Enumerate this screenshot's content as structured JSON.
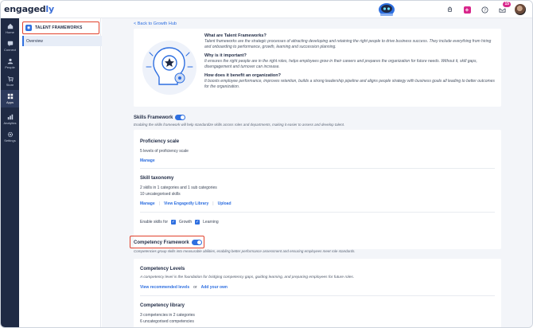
{
  "app": {
    "logo_main": "engaged",
    "logo_accent": "ly",
    "notifications_count": "15"
  },
  "rail": {
    "items": [
      {
        "label": "Home",
        "icon": "home-icon"
      },
      {
        "label": "Connect",
        "icon": "chat-icon"
      },
      {
        "label": "People",
        "icon": "people-icon"
      },
      {
        "label": "Store",
        "icon": "cart-icon"
      },
      {
        "label": "Apps",
        "icon": "apps-icon"
      },
      {
        "label": "Analytics",
        "icon": "analytics-icon"
      },
      {
        "label": "Settings",
        "icon": "gear-icon"
      }
    ]
  },
  "subside": {
    "header": "TALENT FRAMEWORKS",
    "items": [
      {
        "label": "Overview"
      }
    ]
  },
  "main": {
    "back_link": "< Back to Growth Hub",
    "about": {
      "q1": "What are Talent Frameworks?",
      "a1": "Talent frameworks are the strategic processes of attracting developing and retaining the right people to drive business success. They include everything from hiring and onboarding to performance, growth, learning and succession planning.",
      "q2": "Why is it important?",
      "a2": "It ensures the right people are in the right roles, helps employees grow in their careers and prepares the organization for future needs. Without it, skill gaps, disengagement and turnover can increase.",
      "q3": "How does it benefit an organization?",
      "a3": "It boosts employee performance, improves retention, builds a strong leadership pipeline and aligns people strategy with business goals all leading to better outcomes for the organization."
    },
    "skills": {
      "title": "Skills Framework",
      "desc": "Enabling the skills framework will help standardize skills across roles and departments, making it easier to assess and develop talent.",
      "proficiency_title": "Proficiency scale",
      "proficiency_text": "5 levels of proficiency scale",
      "manage": "Manage",
      "taxonomy_title": "Skill taxonomy",
      "taxonomy_line1": "2 skills in 1 categories and 1 sub categories",
      "taxonomy_line2": "10 uncategorised skills",
      "view_library": "View Engagedly Library",
      "upload": "Upload",
      "enable_for": "Enable skills for",
      "growth": "Growth",
      "learning": "Learning"
    },
    "competency": {
      "title": "Competency Framework",
      "desc": "Competencies group skills into measurable abilities, enabling better performance assessment and ensuring employees meet role standards.",
      "levels_title": "Competency Levels",
      "levels_text": "A competency level is the foundation for bridging competency gaps, guiding learning, and preparing employees for future roles.",
      "view_recommended": "View recommended levels",
      "or": "or",
      "add_own": "Add your own",
      "library_title": "Competency library",
      "library_line1": "3 competencies in 2 categories",
      "library_line2": "6 uncategorised competencies"
    }
  }
}
